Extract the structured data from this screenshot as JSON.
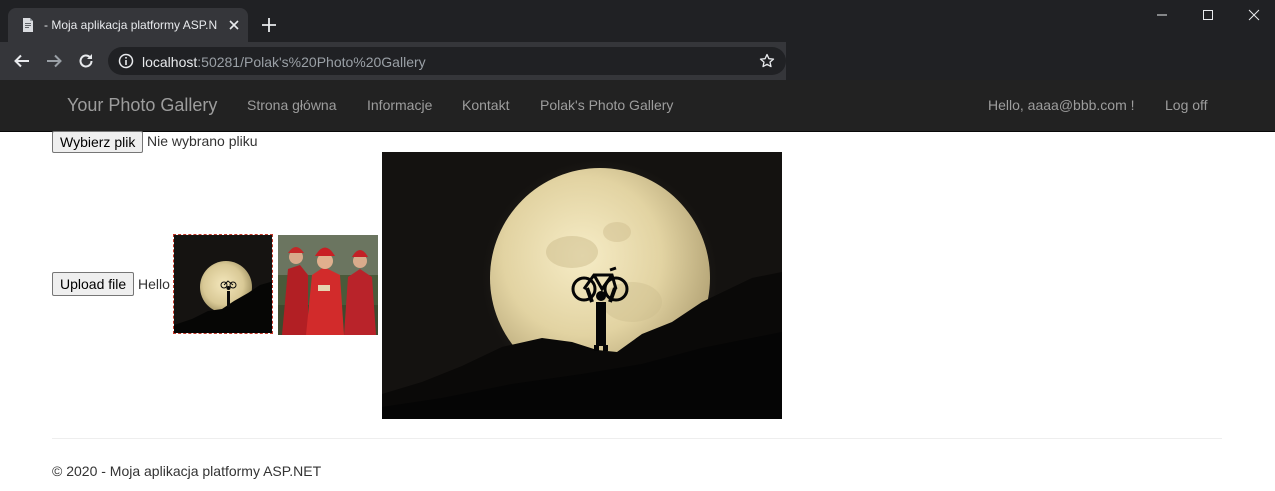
{
  "browser": {
    "tab_title": "- Moja aplikacja platformy ASP.N",
    "url_host": "localhost",
    "url_rest": ":50281/Polak's%20Photo%20Gallery"
  },
  "navbar": {
    "brand": "Your Photo Gallery",
    "links": [
      "Strona główna",
      "Informacje",
      "Kontakt",
      "Polak's Photo Gallery"
    ],
    "greeting": "Hello, aaaa@bbb.com !",
    "logoff": "Log off"
  },
  "upload": {
    "choose_label": "Wybierz plik",
    "no_file_label": "Nie wybrano pliku",
    "upload_label": "Upload file",
    "hello_text": "Hello"
  },
  "gallery": {
    "thumbnails": [
      "moon-bike-thumbnail",
      "red-robes-thumbnail"
    ],
    "selected_index": 0,
    "preview": "moon-bike-preview"
  },
  "footer": {
    "text": "© 2020 - Moja aplikacja platformy ASP.NET"
  }
}
